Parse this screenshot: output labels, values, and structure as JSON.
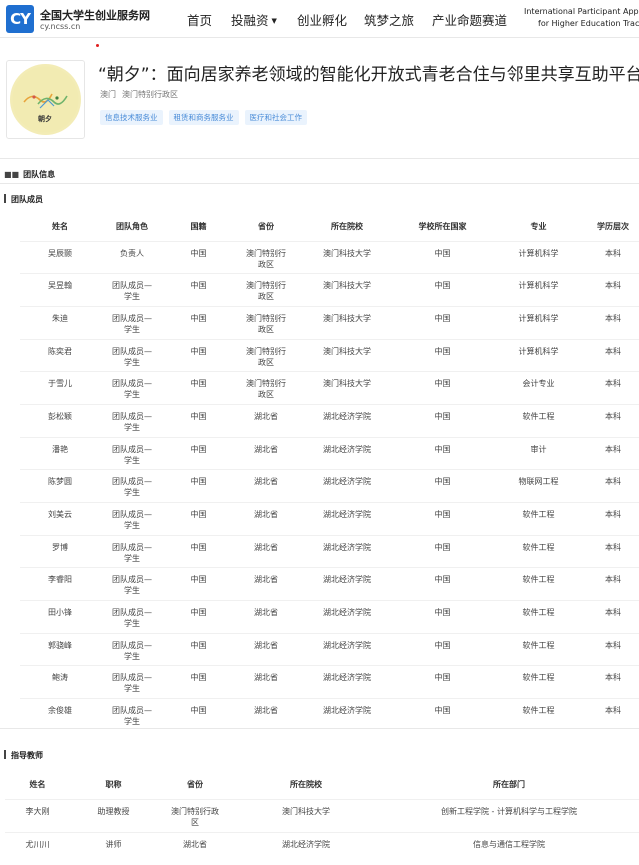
{
  "header": {
    "logo_mark": "CY",
    "site_title": "全国大学生创业服务网",
    "site_url": "cy.ncss.cn",
    "nav": [
      {
        "label": "首页"
      },
      {
        "label": "投融资",
        "has_dropdown": true
      },
      {
        "label": "创业孵化"
      },
      {
        "label": "筑梦之旅"
      },
      {
        "label": "产业命题赛道"
      }
    ],
    "intl_line1": "International Participant Applications",
    "intl_line2": "for Higher Education Track"
  },
  "project": {
    "logo_text": "朝夕",
    "title": "“朝夕”：面向居家养老领域的智能化开放式青老合住与邻里共享互助平台",
    "location": [
      "澳门",
      "澳门特别行政区"
    ],
    "tags": [
      "信息技术服务业",
      "租赁和商务服务业",
      "医疗和社会工作"
    ]
  },
  "team_section": {
    "title": "团队信息",
    "members_title": "团队成员",
    "columns": [
      "姓名",
      "团队角色",
      "国籍",
      "省份",
      "所在院校",
      "学校所在国家",
      "专业",
      "学历层次"
    ],
    "rows": [
      [
        "吴辰颢",
        "负责人",
        "中国",
        "澳门特别行政区",
        "澳门科技大学",
        "中国",
        "计算机科学",
        "本科"
      ],
      [
        "吴昱翰",
        "团队成员—学生",
        "中国",
        "澳门特别行政区",
        "澳门科技大学",
        "中国",
        "计算机科学",
        "本科"
      ],
      [
        "朱迪",
        "团队成员—学生",
        "中国",
        "澳门特别行政区",
        "澳门科技大学",
        "中国",
        "计算机科学",
        "本科"
      ],
      [
        "陈奕君",
        "团队成员—学生",
        "中国",
        "澳门特别行政区",
        "澳门科技大学",
        "中国",
        "计算机科学",
        "本科"
      ],
      [
        "于雪儿",
        "团队成员—学生",
        "中国",
        "澳门特别行政区",
        "澳门科技大学",
        "中国",
        "会计专业",
        "本科"
      ],
      [
        "彭松颖",
        "团队成员—学生",
        "中国",
        "湖北省",
        "湖北经济学院",
        "中国",
        "软件工程",
        "本科"
      ],
      [
        "潘艳",
        "团队成员—学生",
        "中国",
        "湖北省",
        "湖北经济学院",
        "中国",
        "审计",
        "本科"
      ],
      [
        "陈梦圆",
        "团队成员—学生",
        "中国",
        "湖北省",
        "湖北经济学院",
        "中国",
        "物联网工程",
        "本科"
      ],
      [
        "刘美云",
        "团队成员—学生",
        "中国",
        "湖北省",
        "湖北经济学院",
        "中国",
        "软件工程",
        "本科"
      ],
      [
        "罗博",
        "团队成员—学生",
        "中国",
        "湖北省",
        "湖北经济学院",
        "中国",
        "软件工程",
        "本科"
      ],
      [
        "李睿阳",
        "团队成员—学生",
        "中国",
        "湖北省",
        "湖北经济学院",
        "中国",
        "软件工程",
        "本科"
      ],
      [
        "田小锋",
        "团队成员—学生",
        "中国",
        "湖北省",
        "湖北经济学院",
        "中国",
        "软件工程",
        "本科"
      ],
      [
        "郭骁峰",
        "团队成员—学生",
        "中国",
        "湖北省",
        "湖北经济学院",
        "中国",
        "软件工程",
        "本科"
      ],
      [
        "鲍涛",
        "团队成员—学生",
        "中国",
        "湖北省",
        "湖北经济学院",
        "中国",
        "软件工程",
        "本科"
      ],
      [
        "余俊雄",
        "团队成员—学生",
        "中国",
        "湖北省",
        "湖北经济学院",
        "中国",
        "软件工程",
        "本科"
      ]
    ]
  },
  "teacher_section": {
    "title": "指导教师",
    "columns": [
      "姓名",
      "职称",
      "省份",
      "所在院校",
      "所在部门"
    ],
    "rows": [
      [
        "李大刚",
        "助理教授",
        "澳门特别行政区",
        "澳门科技大学",
        "创新工程学院 - 计算机科学与工程学院"
      ],
      [
        "尤川川",
        "讲师",
        "湖北省",
        "湖北经济学院",
        "信息与通信工程学院"
      ]
    ]
  }
}
